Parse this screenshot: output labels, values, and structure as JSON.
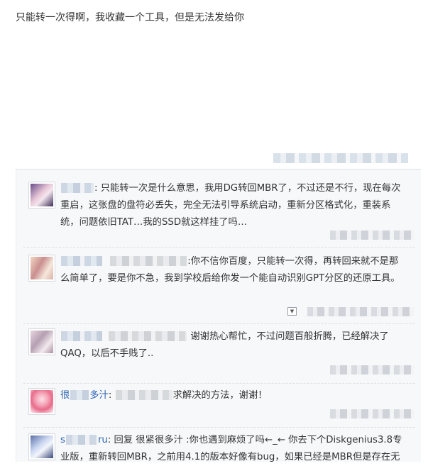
{
  "main_post": {
    "text": "只能转一次得啊，我收藏一个工具，但是无法发给你"
  },
  "replies": [
    {
      "text": ": 只能转一次是什么意思，我用DG转回MBR了，不过还是不行，现在每次重启，这张盘的盘符必丢失，完全无法引导系统启动，重新分区格式化，重装系统，问题依旧TAT…我的SSD就这样挂了吗…"
    },
    {
      "text": ":你不信你百度，只能转一次得，再转回来就不是那么简单了，要是你不急，我到学校后给你发一个能自动识别GPT分区的还原工具。"
    },
    {
      "text": "谢谢热心帮忙，不过问题百般折腾，已经解决了QAQ，以后不手贱了.."
    },
    {
      "name_start": "很",
      "name_end": "多汁",
      "text": "求解决的方法，谢谢！"
    },
    {
      "name_start": "s",
      "name_end": "ru",
      "text": ": 回复 很紧很多汁 :你也遇到麻烦了吗←_← 你去下个Diskgenius3.8专业版，重新转回MBR，之前用4.1的版本好像有bug，如果已经是MBR但是存在无"
    }
  ],
  "icons": {
    "dropdown": "dropdown-arrow-icon"
  },
  "colors": {
    "username": "#2d64b3",
    "text": "#333333",
    "reply_bg": "#f7f8fa"
  }
}
